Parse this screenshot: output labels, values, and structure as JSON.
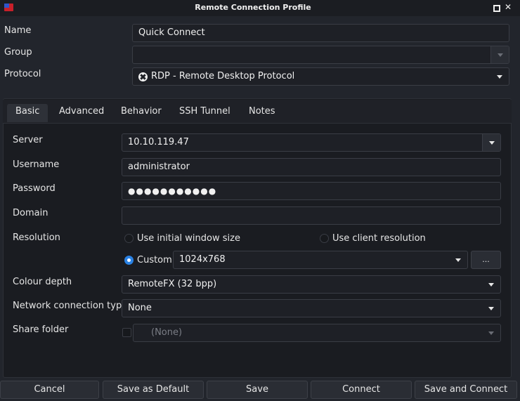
{
  "window": {
    "title": "Remote Connection Profile"
  },
  "profile": {
    "name_label": "Name",
    "name_value": "Quick Connect",
    "group_label": "Group",
    "group_value": "",
    "protocol_label": "Protocol",
    "protocol_value": "RDP - Remote Desktop Protocol"
  },
  "tabs": [
    {
      "label": "Basic",
      "active": true
    },
    {
      "label": "Advanced",
      "active": false
    },
    {
      "label": "Behavior",
      "active": false
    },
    {
      "label": "SSH Tunnel",
      "active": false
    },
    {
      "label": "Notes",
      "active": false
    }
  ],
  "basic": {
    "server_label": "Server",
    "server_value": "10.10.119.47",
    "username_label": "Username",
    "username_value": "administrator",
    "password_label": "Password",
    "password_value": "●●●●●●●●●●●",
    "domain_label": "Domain",
    "domain_value": "",
    "resolution_label": "Resolution",
    "res_option_initial": "Use initial window size",
    "res_option_client": "Use client resolution",
    "res_option_custom": "Custom",
    "res_custom_value": "1024x768",
    "res_more_button": "...",
    "colour_depth_label": "Colour depth",
    "colour_depth_value": "RemoteFX (32 bpp)",
    "network_label": "Network connection type",
    "network_value": "None",
    "share_folder_label": "Share folder",
    "share_folder_value": "(None)"
  },
  "buttons": {
    "cancel": "Cancel",
    "save_default": "Save as Default",
    "save": "Save",
    "connect": "Connect",
    "save_connect": "Save and Connect"
  },
  "colors": {
    "accent": "#2a82e4",
    "background": "#22252c",
    "panel": "#1a1c21",
    "field": "#1e2026"
  },
  "icons": {
    "app": "remmina-flag-icon",
    "protocol": "rdp-icon"
  }
}
